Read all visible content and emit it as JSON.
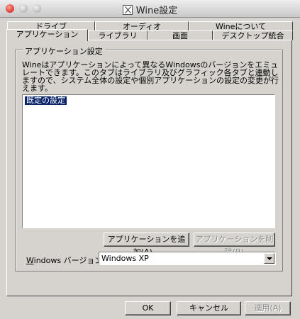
{
  "window": {
    "title": "Wine設定"
  },
  "tabs_row1": [
    {
      "label": "ドライブ"
    },
    {
      "label": "オーディオ"
    },
    {
      "label": "Wineについて"
    }
  ],
  "tabs_row2": [
    {
      "label": "アプリケーション",
      "selected": true
    },
    {
      "label": "ライブラリ"
    },
    {
      "label": "画面"
    },
    {
      "label": "デスクトップ統合"
    }
  ],
  "app_settings": {
    "group_title": "アプリケーション設定",
    "description": "Wineはアプリケーションによって異なるWindowsのバージョンをエミュレートできます。このタブはライブラリ及びグラフィック各タブと連動しますので、システム全体の設定や個別アプリケーションの設定の変更が行えます。",
    "list_items": [
      "既定の設定"
    ],
    "add_button": "アプリケーションを追加(A)...",
    "remove_button": "アプリケーションを削除(R)",
    "version_label_underlined": "W",
    "version_label_rest": "indows バージョン:",
    "version_value": "Windows XP"
  },
  "footer": {
    "ok": "OK",
    "cancel": "キャンセル",
    "apply": "適用(A)"
  },
  "colors": {
    "face": "#d6d3ce",
    "selection": "#0a246a"
  }
}
